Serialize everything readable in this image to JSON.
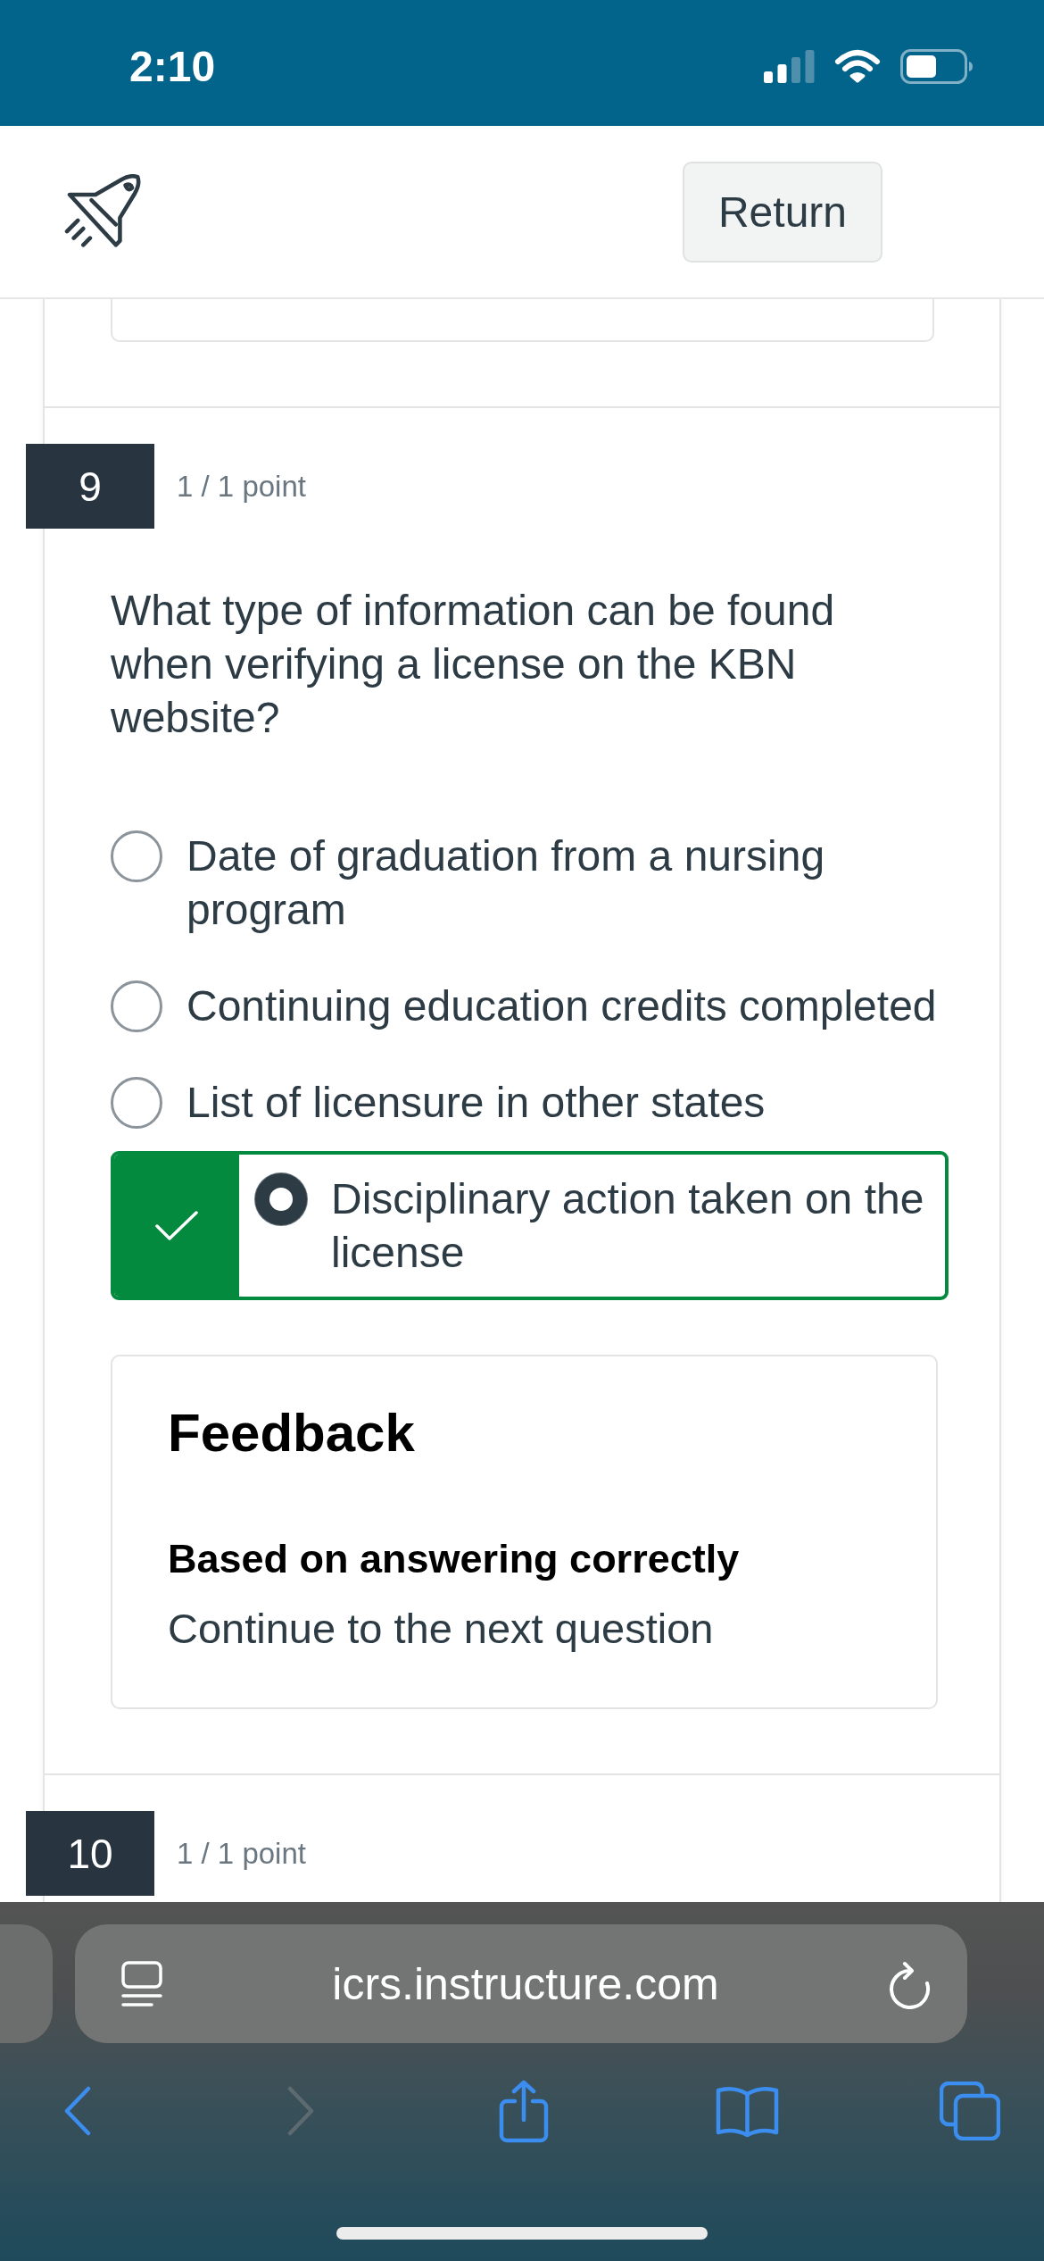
{
  "status_bar": {
    "time": "2:10"
  },
  "header": {
    "button": "Return"
  },
  "questions": [
    {
      "number": "9",
      "score": "1 / 1 point",
      "text": "What type of information can be found when verifying a license on the KBN website?",
      "answers": [
        {
          "text": "Date of graduation from a nursing program",
          "selected": false,
          "correct": false
        },
        {
          "text": "Continuing education credits completed",
          "selected": false,
          "correct": false
        },
        {
          "text": "List of licensure in other states",
          "selected": false,
          "correct": false
        },
        {
          "text": "Disciplinary action taken on the license",
          "selected": true,
          "correct": true
        }
      ],
      "feedback": {
        "title": "Feedback",
        "subtitle": "Based on answering correctly",
        "text": "Continue to the next question"
      }
    },
    {
      "number": "10",
      "score": "1 / 1 point"
    }
  ],
  "browser": {
    "url": "icrs.instructure.com",
    "toolbar": [
      {
        "kind": "back",
        "disabled": false
      },
      {
        "kind": "forward",
        "disabled": true
      },
      {
        "kind": "share",
        "disabled": false
      },
      {
        "kind": "bookmarks",
        "disabled": false
      },
      {
        "kind": "tabs",
        "disabled": false
      }
    ]
  }
}
